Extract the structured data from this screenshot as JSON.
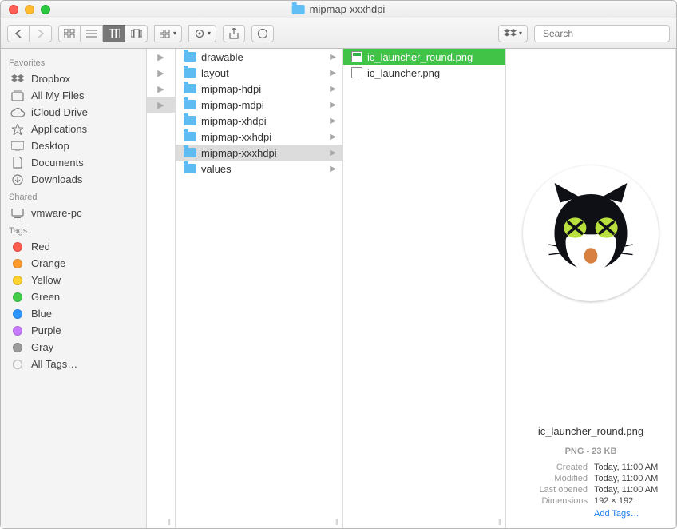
{
  "window": {
    "title": "mipmap-xxxhdpi"
  },
  "search": {
    "placeholder": "Search"
  },
  "sidebar": {
    "sections": [
      {
        "header": "Favorites",
        "items": [
          {
            "icon": "dropbox",
            "label": "Dropbox"
          },
          {
            "icon": "allfiles",
            "label": "All My Files"
          },
          {
            "icon": "cloud",
            "label": "iCloud Drive"
          },
          {
            "icon": "apps",
            "label": "Applications"
          },
          {
            "icon": "desktop",
            "label": "Desktop"
          },
          {
            "icon": "docs",
            "label": "Documents"
          },
          {
            "icon": "downloads",
            "label": "Downloads"
          }
        ]
      },
      {
        "header": "Shared",
        "items": [
          {
            "icon": "pc",
            "label": "vmware-pc"
          }
        ]
      },
      {
        "header": "Tags",
        "items": [
          {
            "icon": "tag",
            "color": "#ff5b4e",
            "label": "Red"
          },
          {
            "icon": "tag",
            "color": "#ff9a2e",
            "label": "Orange"
          },
          {
            "icon": "tag",
            "color": "#ffd22e",
            "label": "Yellow"
          },
          {
            "icon": "tag",
            "color": "#42ce4b",
            "label": "Green"
          },
          {
            "icon": "tag",
            "color": "#2e97ff",
            "label": "Blue"
          },
          {
            "icon": "tag",
            "color": "#c57aff",
            "label": "Purple"
          },
          {
            "icon": "tag",
            "color": "#9c9c9c",
            "label": "Gray"
          },
          {
            "icon": "alltags",
            "label": "All Tags…"
          }
        ]
      }
    ]
  },
  "column2": {
    "items": [
      {
        "label": "drawable"
      },
      {
        "label": "layout"
      },
      {
        "label": "mipmap-hdpi"
      },
      {
        "label": "mipmap-mdpi"
      },
      {
        "label": "mipmap-xhdpi"
      },
      {
        "label": "mipmap-xxhdpi"
      },
      {
        "label": "mipmap-xxxhdpi",
        "selected": true
      },
      {
        "label": "values"
      }
    ]
  },
  "column3": {
    "items": [
      {
        "label": "ic_launcher_round.png",
        "selected": true
      },
      {
        "label": "ic_launcher.png"
      }
    ]
  },
  "preview": {
    "filename": "ic_launcher_round.png",
    "subtitle": "PNG - 23 KB",
    "meta": [
      {
        "k": "Created",
        "v": "Today, 11:00 AM"
      },
      {
        "k": "Modified",
        "v": "Today, 11:00 AM"
      },
      {
        "k": "Last opened",
        "v": "Today, 11:00 AM"
      },
      {
        "k": "Dimensions",
        "v": "192 × 192"
      }
    ],
    "add_tags": "Add Tags…"
  }
}
